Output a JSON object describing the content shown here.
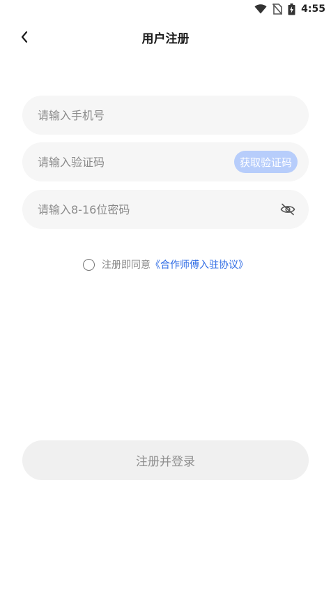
{
  "status_bar": {
    "time": "4:55",
    "icons": [
      "wifi-icon",
      "no-sim-icon",
      "battery-charging-icon"
    ]
  },
  "header": {
    "title": "用户注册",
    "back_icon": "chevron-left-icon"
  },
  "form": {
    "phone": {
      "placeholder": "请输入手机号",
      "value": ""
    },
    "code": {
      "placeholder": "请输入验证码",
      "value": "",
      "button_label": "获取验证码"
    },
    "password": {
      "placeholder": "请输入8-16位密码",
      "value": "",
      "toggle_icon": "eye-off-icon"
    }
  },
  "agreement": {
    "checked": false,
    "prefix": "注册即同意",
    "link": "《合作师傅入驻协议》"
  },
  "submit": {
    "label": "注册并登录"
  },
  "colors": {
    "accent_link": "#2f6ce5",
    "code_button_bg": "#b7cdfb",
    "field_bg": "#f6f6f6",
    "submit_bg": "#f0f0f0"
  }
}
